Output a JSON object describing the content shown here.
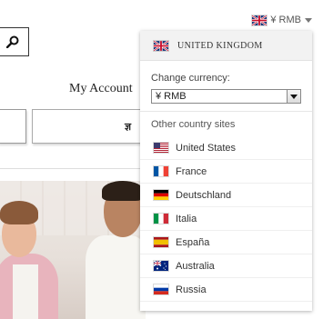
{
  "header": {
    "currency_label": "¥ RMB",
    "flag_icon": "uk-flag-icon"
  },
  "page": {
    "my_account": "My Account",
    "button_text": "ज्ञ",
    "search_icon": "search-icon"
  },
  "dropdown": {
    "current_country": "UNITED KINGDOM",
    "change_currency_label": "Change currency:",
    "currency_value": "¥ RMB",
    "other_sites_label": "Other country sites",
    "countries": [
      {
        "label": "United States",
        "flag": "us-flag-icon"
      },
      {
        "label": "France",
        "flag": "fr-flag-icon"
      },
      {
        "label": "Deutschland",
        "flag": "de-flag-icon"
      },
      {
        "label": "Italia",
        "flag": "it-flag-icon"
      },
      {
        "label": "España",
        "flag": "es-flag-icon"
      },
      {
        "label": "Australia",
        "flag": "au-flag-icon"
      },
      {
        "label": "Russia",
        "flag": "ru-flag-icon"
      }
    ]
  }
}
